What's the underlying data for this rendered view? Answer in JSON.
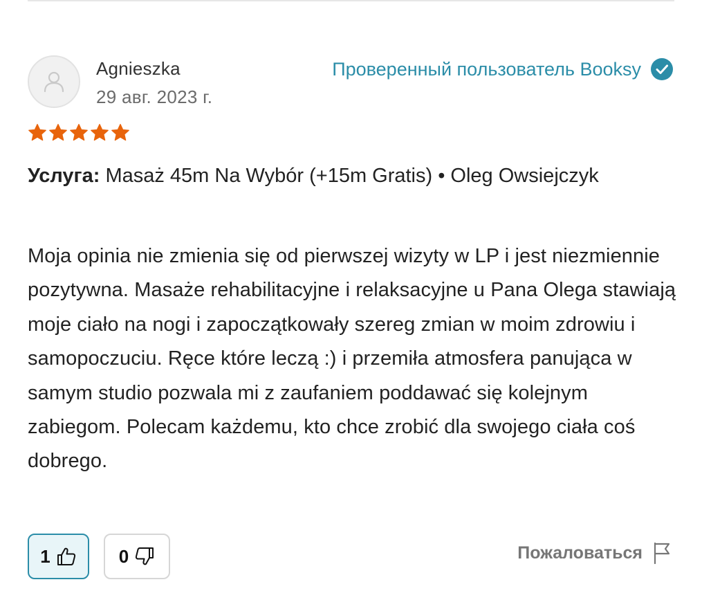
{
  "review": {
    "reviewer_name": "Agnieszka",
    "date": "29 авг. 2023 г.",
    "verified_label": "Проверенный пользователь Booksy",
    "rating": 5,
    "service_label": "Услуга:",
    "service_value": "Masaż 45m Na Wybór (+15m Gratis) • Oleg Owsiejczyk",
    "text": "Moja opinia nie zmienia się od pierwszej wizyty w LP i jest niezmiennie pozytywna. Masaże rehabilitacyjne i relaksacyjne u Pana Olega stawiają moje ciało na nogi i zapoczątkowały szereg zmian w moim zdrowiu i samopoczuciu. Ręce które leczą :) i przemiła atmosfera panująca w samym studio pozwala mi z zaufaniem poddawać się kolejnym zabiegom. Polecam każdemu, kto chce zrobić dla swojego ciała coś dobrego."
  },
  "votes": {
    "helpful_count": "1",
    "unhelpful_count": "0"
  },
  "actions": {
    "report_label": "Пожаловаться"
  },
  "icons": {
    "avatar": "user-placeholder-icon",
    "verified": "check-circle-icon",
    "star": "star-icon",
    "thumbs_up": "thumbs-up-icon",
    "thumbs_down": "thumbs-down-icon",
    "report": "flag-icon"
  },
  "colors": {
    "accent": "#2b8da8",
    "star": "#e8640c",
    "text": "#222222",
    "muted": "#6b6b6b"
  }
}
